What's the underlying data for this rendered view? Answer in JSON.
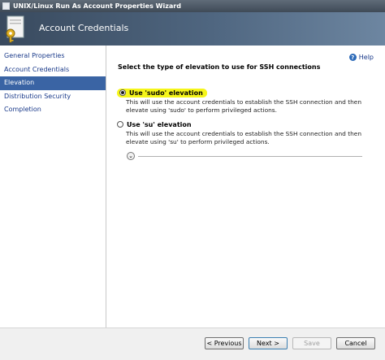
{
  "window": {
    "title": "UNIX/Linux Run As Account Properties Wizard"
  },
  "banner": {
    "heading": "Account Credentials"
  },
  "sidebar": {
    "items": [
      {
        "label": "General Properties"
      },
      {
        "label": "Account Credentials"
      },
      {
        "label": "Elevation",
        "active": true
      },
      {
        "label": "Distribution Security"
      },
      {
        "label": "Completion"
      }
    ]
  },
  "content": {
    "help_label": "Help",
    "section_title": "Select the type of elevation to use for SSH connections",
    "options": [
      {
        "label": "Use 'sudo' elevation",
        "selected": true,
        "highlighted": true,
        "description": "This will use the account credentials to establish the SSH connection and then elevate using 'sudo' to perform privileged actions."
      },
      {
        "label": "Use 'su' elevation",
        "selected": false,
        "description": "This will use the account credentials to establish the SSH connection and then elevate using 'su' to perform privileged actions."
      }
    ]
  },
  "footer": {
    "previous_label": "< Previous",
    "next_label": "Next >",
    "save_label": "Save",
    "cancel_label": "Cancel"
  },
  "colors": {
    "highlight": "#f5f51a",
    "active_nav": "#3a64a4",
    "link": "#1a3a8a"
  }
}
